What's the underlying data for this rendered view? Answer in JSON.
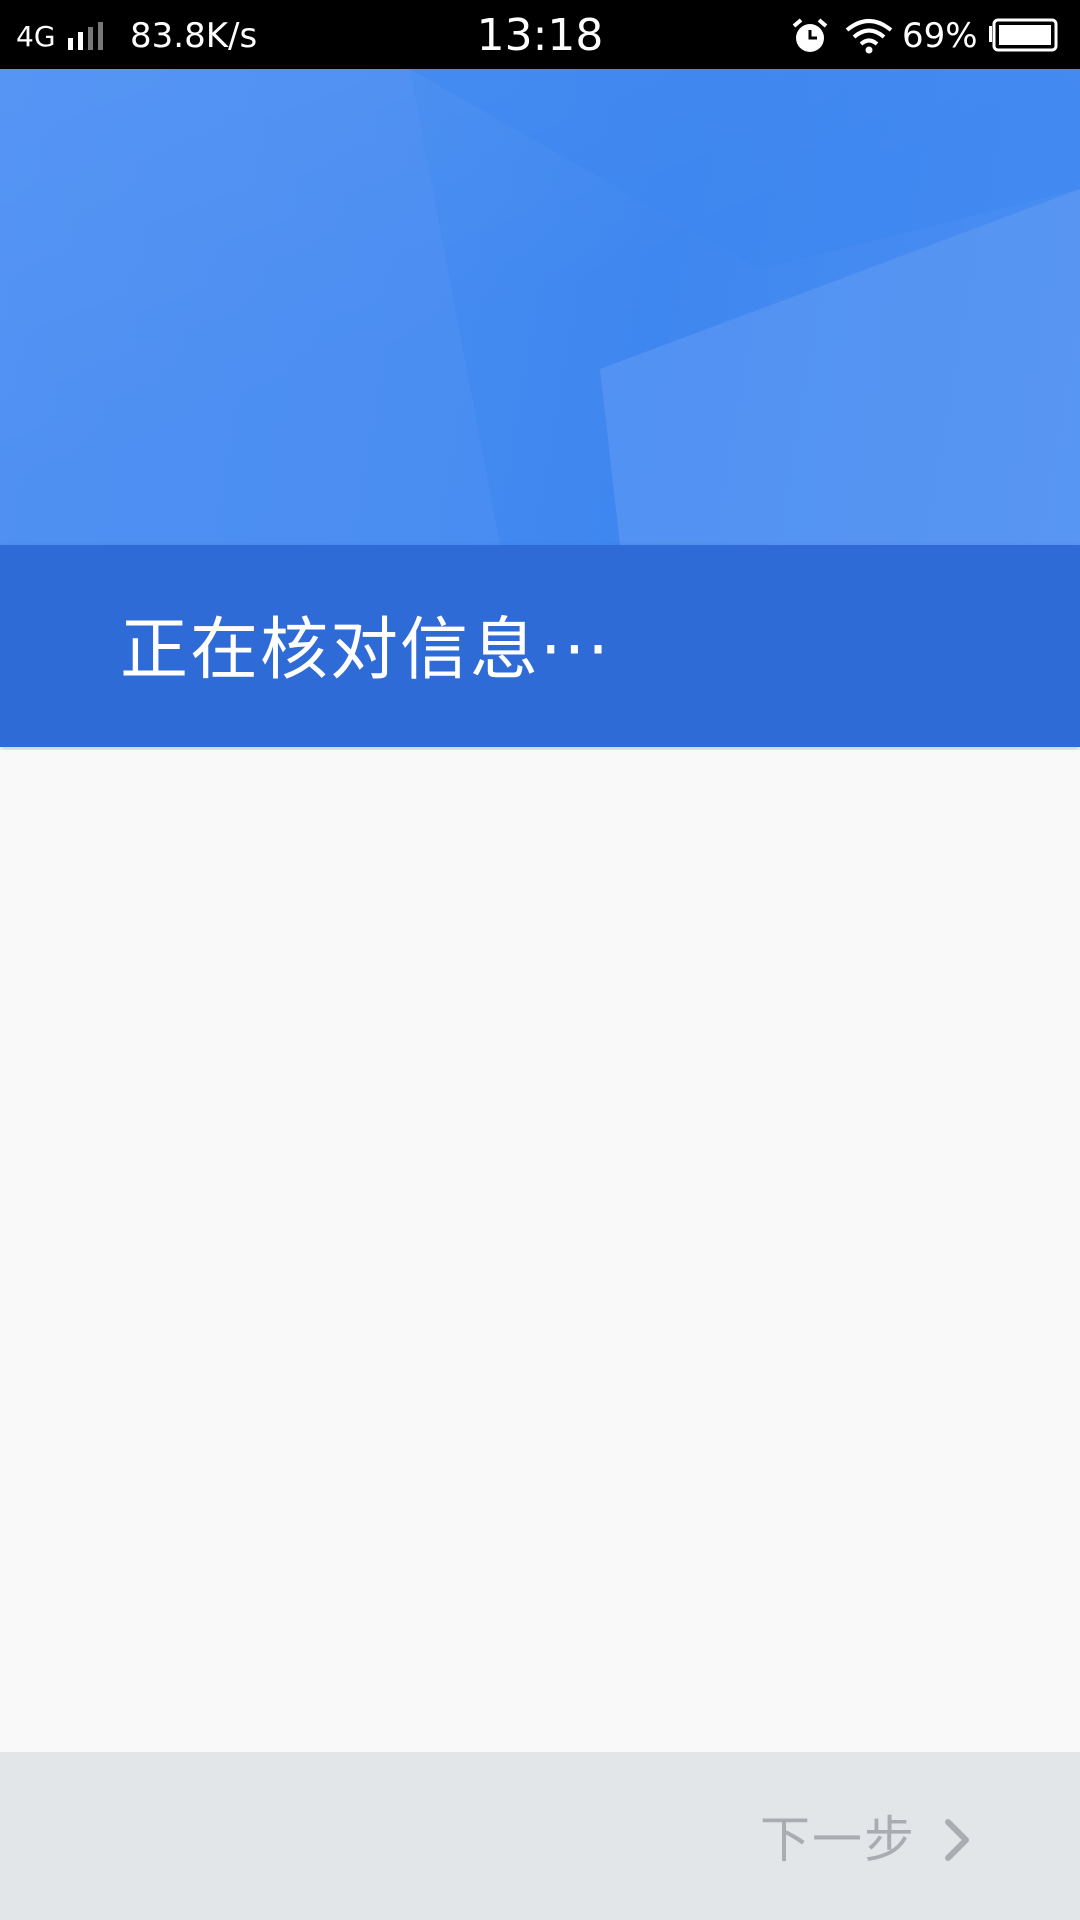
{
  "status_bar": {
    "network": "4G",
    "speed": "83.8K/s",
    "time": "13:18",
    "battery_pct": "69%"
  },
  "banner": {
    "title": "正在核对信息···"
  },
  "bottom_bar": {
    "next_label": "下一步"
  },
  "colors": {
    "header_blue": "#3f87f0",
    "banner_blue": "#2f6bd6",
    "content_bg": "#f9f9f9",
    "bottom_bg": "#e3e6e8",
    "next_text": "#a9adb1"
  }
}
